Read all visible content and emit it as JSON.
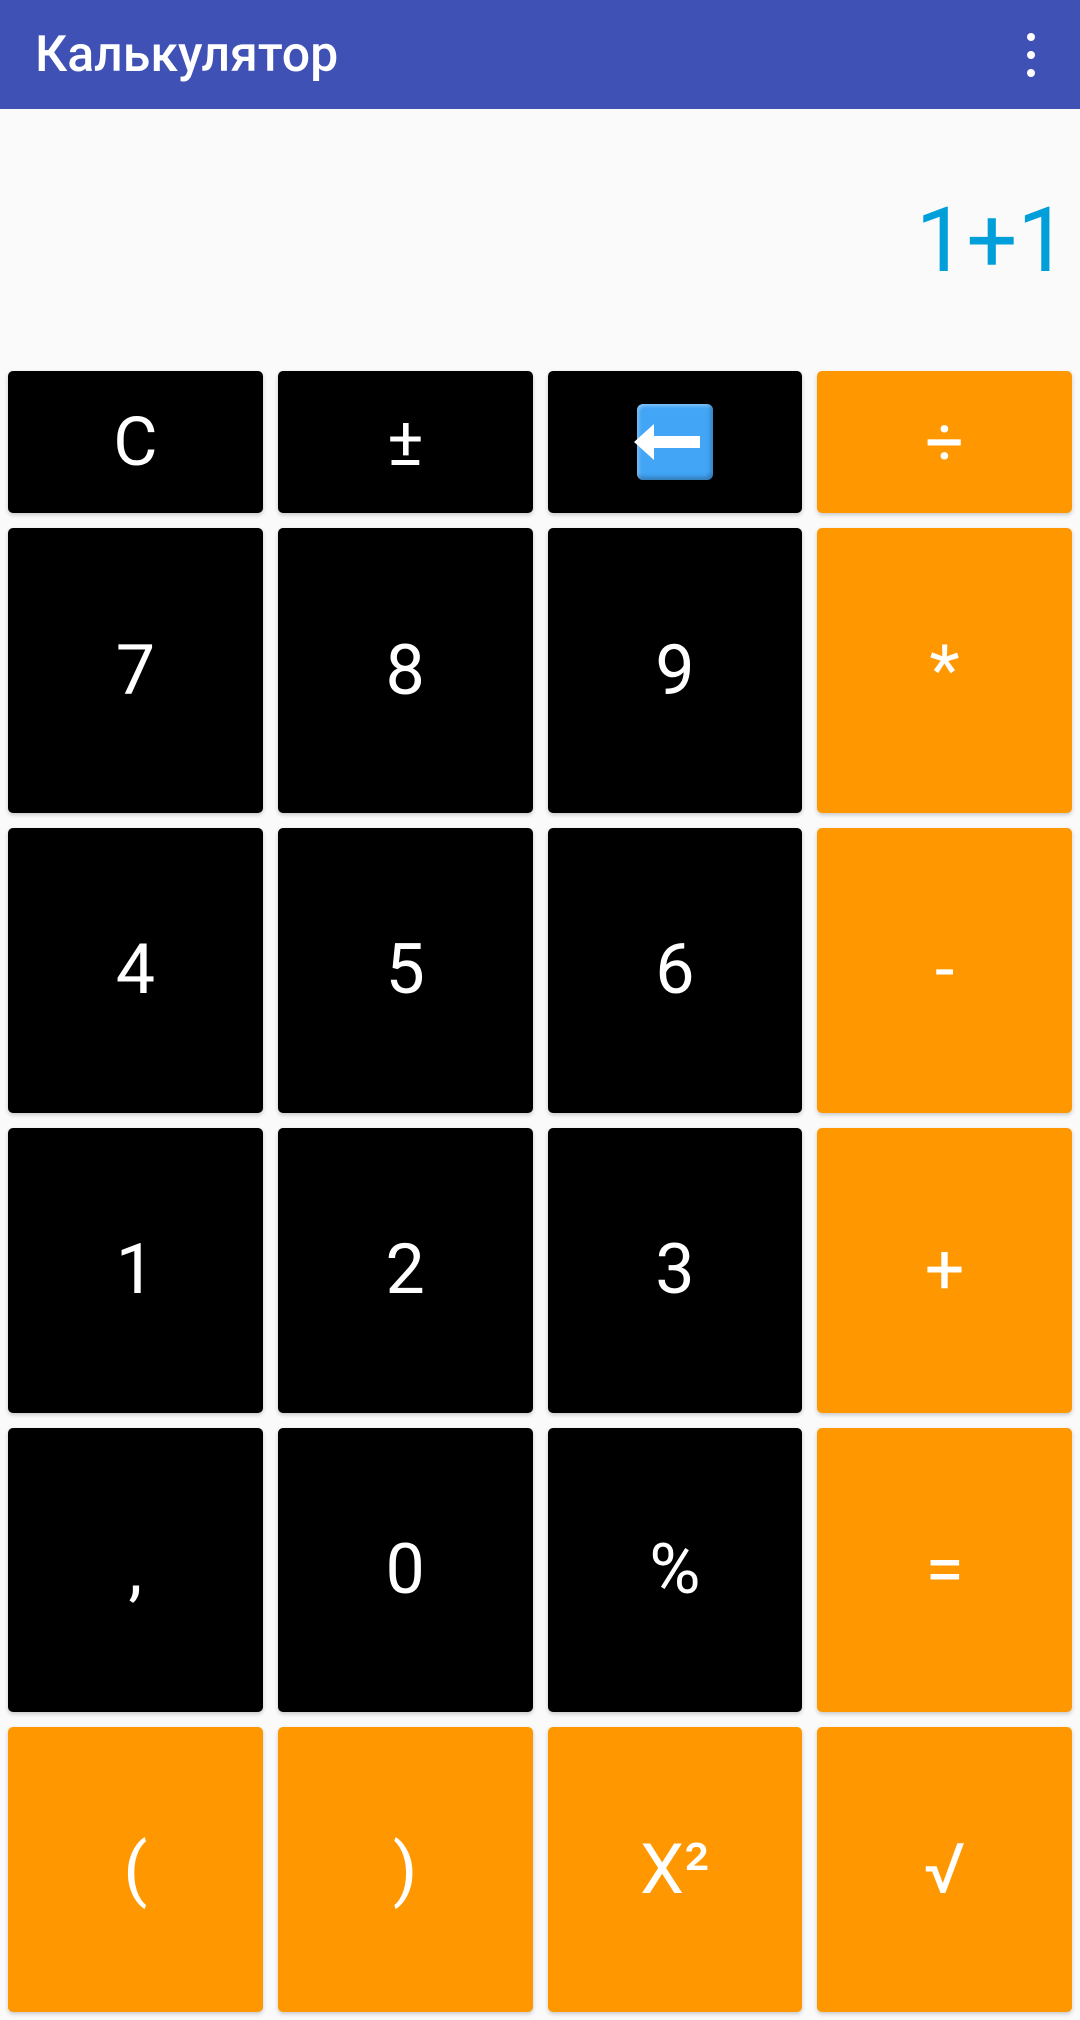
{
  "header": {
    "title": "Калькулятор"
  },
  "display": {
    "expression": "1+1"
  },
  "keys": {
    "clear": "C",
    "plusminus": "±",
    "divide": "÷",
    "seven": "7",
    "eight": "8",
    "nine": "9",
    "multiply": "*",
    "four": "4",
    "five": "5",
    "six": "6",
    "subtract": "-",
    "one": "1",
    "two": "2",
    "three": "3",
    "add": "+",
    "comma": ",",
    "zero": "0",
    "percent": "%",
    "equals": "=",
    "lparen": "(",
    "rparen": ")",
    "square": "X²",
    "sqrt": "√"
  },
  "colors": {
    "header_bg": "#3f51b5",
    "display_text": "#009fda",
    "key_black": "#000000",
    "key_orange": "#ff9800",
    "backspace_bg": "#42a5f5"
  }
}
